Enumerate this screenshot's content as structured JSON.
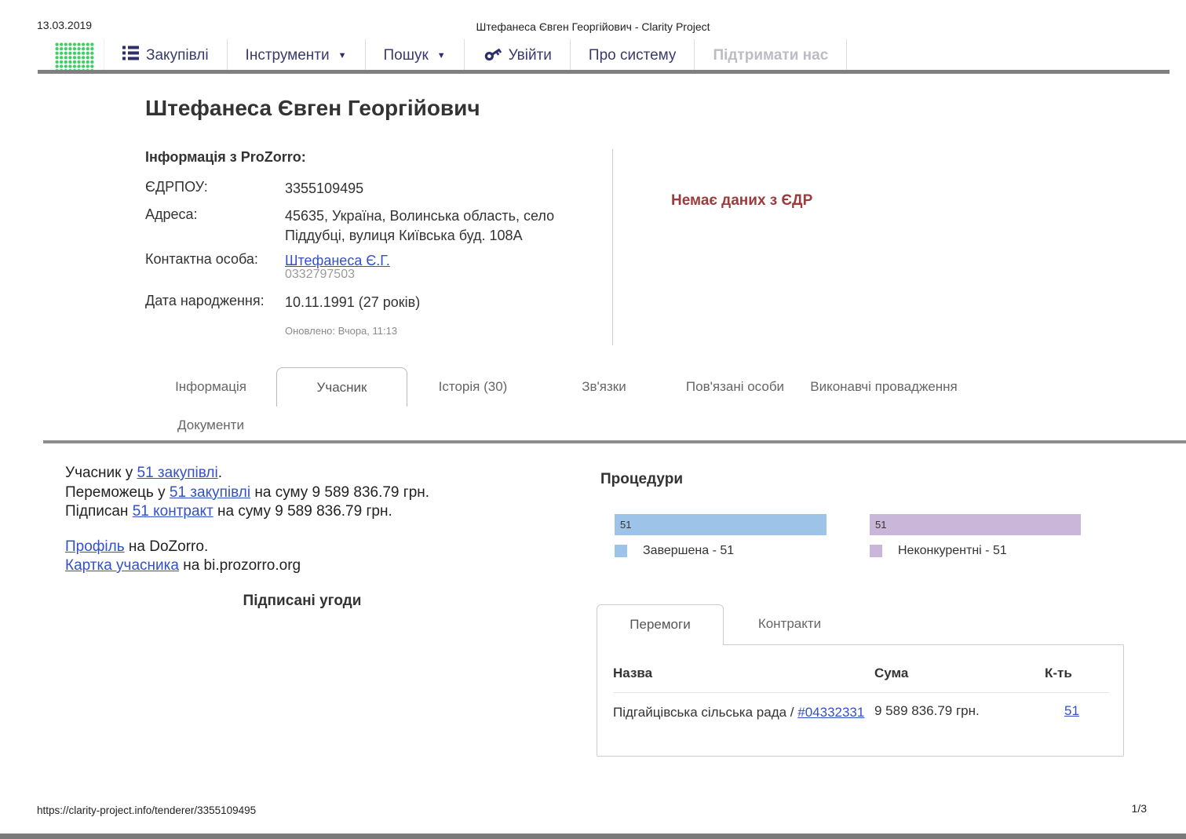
{
  "print_header": {
    "date": "13.03.2019",
    "title": "Штефанеса Євген Георгійович - Clarity Project",
    "url": "https://clarity-project.info/tenderer/3355109495",
    "page": "1/3"
  },
  "nav": {
    "items": [
      {
        "label": "Закупівлі",
        "icon": "list-icon"
      },
      {
        "label": "Інструменти",
        "dropdown": true
      },
      {
        "label": "Пошук",
        "dropdown": true
      },
      {
        "label": "Увійти",
        "icon": "key-icon"
      },
      {
        "label": "Про систему"
      },
      {
        "label": "Підтримати нас",
        "muted": true
      }
    ]
  },
  "profile": {
    "name": "Штефанеса Євген Георгійович",
    "info_title": "Інформація з ProZorro:",
    "fields": {
      "edrpou": {
        "label": "ЄДРПОУ:",
        "value": "3355109495"
      },
      "address": {
        "label": "Адреса:",
        "value": "45635, Україна, Волинська область, село Піддубці, вулиця Київська буд. 108А"
      },
      "contact": {
        "label": "Контактна особа:",
        "link": "Штефанеса Є.Г.",
        "phone": "0332797503"
      },
      "birthdate": {
        "label": "Дата народження:",
        "value": "10.11.1991 (27 років)"
      }
    },
    "updated": "Оновлено: Вчора, 11:13",
    "edr_status": "Немає даних з ЄДР"
  },
  "tabs": {
    "row1": [
      "Інформація",
      "Учасник",
      "Історія (30)",
      "Зв'язки",
      "Пов'язані особи",
      "Виконавчі провадження"
    ],
    "row2": [
      "Документи"
    ],
    "active": "Учасник"
  },
  "participant": {
    "line1": {
      "prefix": "Учасник у ",
      "link": "51 закупівлі",
      "suffix": "."
    },
    "line2": {
      "prefix": "Переможець у ",
      "link": "51 закупівлі",
      "suffix": " на суму 9 589 836.79 грн."
    },
    "line3": {
      "prefix": "Підписан ",
      "link": "51 контракт",
      "suffix": " на суму 9 589 836.79 грн."
    },
    "line4": {
      "link": "Профіль",
      "suffix": " на DoZorro."
    },
    "line5": {
      "link": "Картка учасника",
      "suffix": " на bi.prozorro.org"
    },
    "agreements_title": "Підписані угоди"
  },
  "procedures": {
    "title": "Процедури"
  },
  "chart_data": [
    {
      "type": "bar",
      "orientation": "horizontal",
      "categories": [
        "Завершена"
      ],
      "values": [
        51
      ],
      "value_labels": [
        "51"
      ],
      "legend": "Завершена - 51",
      "bar_color": "#9dc3e8",
      "xlim": [
        0,
        51
      ]
    },
    {
      "type": "bar",
      "orientation": "horizontal",
      "categories": [
        "Неконкурентні"
      ],
      "values": [
        51
      ],
      "value_labels": [
        "51"
      ],
      "legend": "Неконкурентні - 51",
      "bar_color": "#c9b6d9",
      "xlim": [
        0,
        51
      ]
    }
  ],
  "results": {
    "tabs": [
      "Перемоги",
      "Контракти"
    ],
    "active": "Перемоги",
    "columns": {
      "name": "Назва",
      "sum": "Сума",
      "count": "К-ть"
    },
    "row": {
      "name": "Підгайцівська сільська рада / ",
      "code_link": "#04332331",
      "sum": "9 589 836.79 грн.",
      "count": "51"
    }
  },
  "colors": {
    "nav_text": "#39396d",
    "accent_green": "#3ecf63",
    "link": "#3350c8",
    "alert_red": "#9b3b3b",
    "bar_blue": "#9dc3e8",
    "bar_purple": "#c9b6d9"
  }
}
